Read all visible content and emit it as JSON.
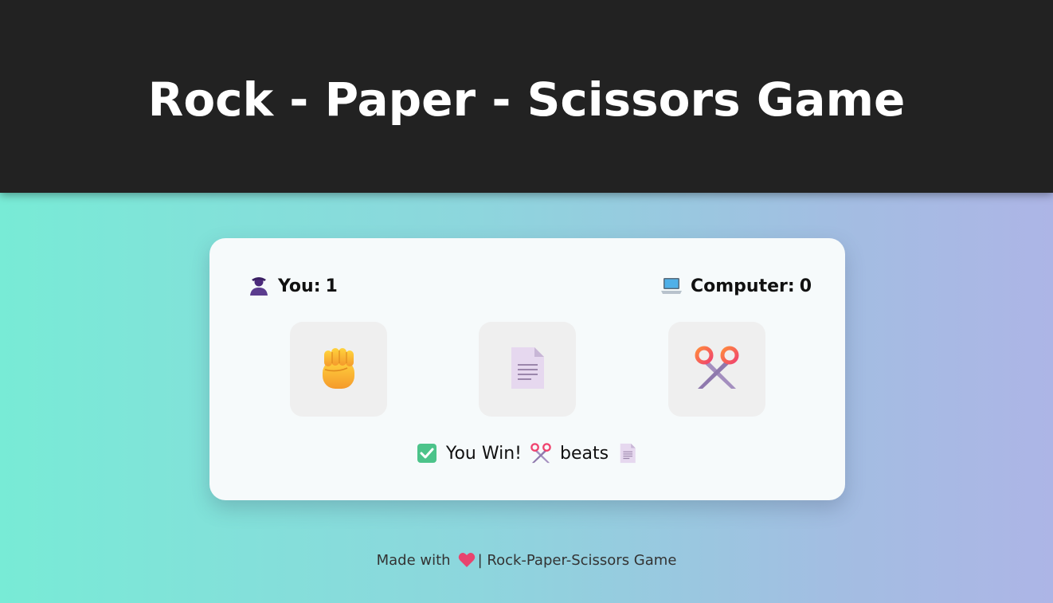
{
  "header": {
    "title": "Rock - Paper - Scissors Game"
  },
  "scoreboard": {
    "user": {
      "label": "You:",
      "score": "1",
      "icon": "user-icon"
    },
    "computer": {
      "label": "Computer:",
      "score": "0",
      "icon": "laptop-icon"
    }
  },
  "choices": [
    {
      "id": "rock",
      "icon": "raised-fist-icon"
    },
    {
      "id": "paper",
      "icon": "document-icon"
    },
    {
      "id": "scissors",
      "icon": "scissors-icon"
    }
  ],
  "result": {
    "status_icon": "check-mark-icon",
    "text": "You Win!",
    "winner_icon": "scissors-icon",
    "verb": "beats",
    "loser_icon": "document-icon"
  },
  "footer": {
    "prefix": "Made with",
    "heart_icon": "heart-icon",
    "suffix": "| Rock-Paper-Scissors Game"
  },
  "colors": {
    "header_bg": "#222222",
    "gradient_start": "#78ebd6",
    "gradient_end": "#adb5e6",
    "card_bg": "#f6fafb",
    "choice_bg": "#efefef",
    "success_green": "#4cc38a"
  }
}
